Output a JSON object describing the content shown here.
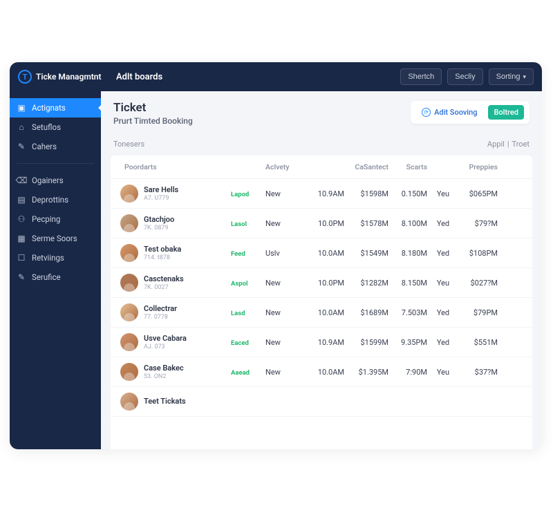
{
  "app_name": "Ticke Managmtnt",
  "board_title": "Adlt boards",
  "top_buttons": {
    "search": "Shertch",
    "secondary": "Secliy",
    "sorting": "Sorting"
  },
  "sidebar": {
    "items": [
      {
        "icon": "▣",
        "label": "Actignats",
        "active": true
      },
      {
        "icon": "⌂",
        "label": "Setuflos"
      },
      {
        "icon": "✎",
        "label": "Cahers"
      }
    ],
    "items2": [
      {
        "icon": "⌫",
        "label": "Ogainers"
      },
      {
        "icon": "▤",
        "label": "Deprottins"
      },
      {
        "icon": "⚇",
        "label": "Pecping"
      },
      {
        "icon": "▦",
        "label": "Serme Soors"
      },
      {
        "icon": "☐",
        "label": "Retviings"
      },
      {
        "icon": "✎",
        "label": "Serufice"
      }
    ]
  },
  "page": {
    "title": "Ticket",
    "subtitle": "Prurt Timted Booking"
  },
  "actions": {
    "secondary": "Adit Sooving",
    "primary": "Boltred"
  },
  "meta": {
    "left": "Tonesers",
    "right1": "Appil",
    "divider": "|",
    "right2": "Troet"
  },
  "columns": {
    "user": "Poordarts",
    "activity": "Aclvety",
    "contact": "CaSantect",
    "scarts": "Scarts",
    "preppies": "Preppies"
  },
  "rows": [
    {
      "name": "Sare Hells",
      "uid": "A7. U779",
      "status": "Lapod",
      "activity": "New",
      "time1": "10.9AM",
      "amount1": "$1598M",
      "amount2": "0.150M",
      "yn": "Yeu",
      "price": "$065PM",
      "avatar": "#e5b48a"
    },
    {
      "name": "Gtachjoo",
      "uid": "7K. 0879",
      "status": "Lasol",
      "activity": "New",
      "time1": "10.0PM",
      "amount1": "$1578M",
      "amount2": "8.100M",
      "yn": "Yed",
      "price": "$79?M",
      "avatar": "#c5a88a"
    },
    {
      "name": "Test obaka",
      "uid": "714. t878",
      "status": "Feed",
      "activity": "Uslv",
      "time1": "10.0AM",
      "amount1": "$1549M",
      "amount2": "8.180M",
      "yn": "Yed",
      "price": "$108PM",
      "avatar": "#d89a6a"
    },
    {
      "name": "Casctenaks",
      "uid": "7K. 0027",
      "status": "Aspol",
      "activity": "New",
      "time1": "10.0PM",
      "amount1": "$1282M",
      "amount2": "8.150M",
      "yn": "Yeu",
      "price": "$027?M",
      "avatar": "#b07a5a"
    },
    {
      "name": "Collectrar",
      "uid": "77. 0778",
      "status": "Lasd",
      "activity": "New",
      "time1": "10.0AM",
      "amount1": "$1689M",
      "amount2": "7.503M",
      "yn": "Yed",
      "price": "$79PM",
      "avatar": "#e8c098"
    },
    {
      "name": "Usve Cabara",
      "uid": "AJ. 073",
      "status": "Eaced",
      "activity": "New",
      "time1": "10.9AM",
      "amount1": "$1599M",
      "amount2": "9.35PM",
      "yn": "Yed",
      "price": "$551M",
      "avatar": "#d4956e"
    },
    {
      "name": "Case Bakec",
      "uid": "53. ON2",
      "status": "Aaead",
      "activity": "New",
      "time1": "10.0AM",
      "amount1": "$1.395M",
      "amount2": "7:90M",
      "yn": "Yeu",
      "price": "$37?M",
      "avatar": "#c8885a"
    },
    {
      "name": "Teet Tickats",
      "uid": "",
      "status": "",
      "activity": "",
      "time1": "",
      "amount1": "",
      "amount2": "",
      "yn": "",
      "price": "",
      "avatar": "#dab090"
    }
  ]
}
